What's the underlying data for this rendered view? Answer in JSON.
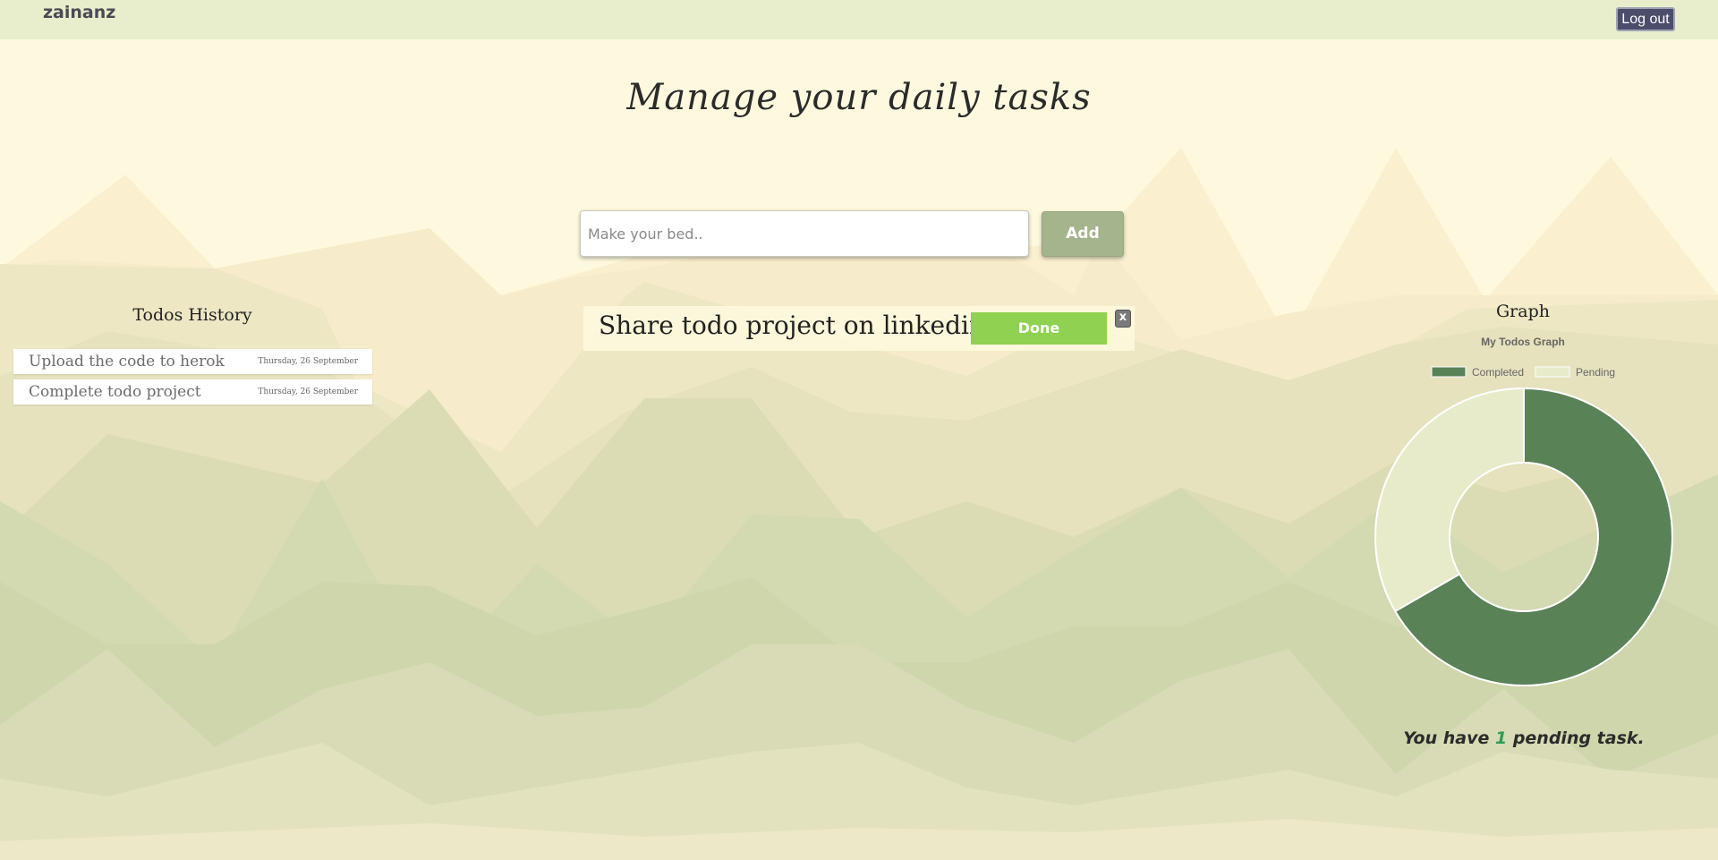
{
  "header": {
    "brand": "zainanz",
    "logout_label": "Log out"
  },
  "main": {
    "title": "Manage your daily tasks",
    "input_placeholder": "Make your bed..",
    "input_value": "",
    "add_label": "Add",
    "todos": [
      {
        "text": "Share todo project on linkedin",
        "done_label": "Done",
        "close_label": "x"
      }
    ]
  },
  "history": {
    "title": "Todos History",
    "items": [
      {
        "text": "Upload the code to herok",
        "date": "Thursday, 26 September"
      },
      {
        "text": "Complete todo project",
        "date": "Thursday, 26 September"
      }
    ]
  },
  "graph": {
    "heading": "Graph",
    "pending_prefix": "You have ",
    "pending_count": "1",
    "pending_suffix": " pending task."
  },
  "chart_data": {
    "type": "pie",
    "title": "My Todos Graph",
    "categories": [
      "Completed",
      "Pending"
    ],
    "values": [
      2,
      1
    ],
    "colors": [
      "#598257",
      "#e7ebc9"
    ],
    "legend": "top",
    "cutout": "donut"
  },
  "colors": {
    "page_background": "#fef9de",
    "topbar": "#e8eecb",
    "logout_button": "#4b4d6b",
    "add_button": "#a4b48c",
    "done_button": "#8fd150",
    "pending_count": "#2e9c57"
  }
}
